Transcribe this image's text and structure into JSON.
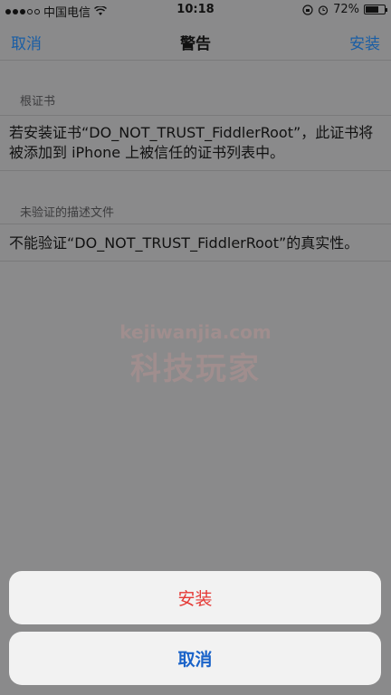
{
  "status_bar": {
    "carrier": "中国电信",
    "time": "10:18",
    "battery_percent": "72%",
    "battery_level": 0.72
  },
  "nav": {
    "left_label": "取消",
    "title": "警告",
    "right_label": "安装"
  },
  "sections": [
    {
      "header": "根证书",
      "body": "若安装证书“DO_NOT_TRUST_FiddlerRoot”，此证书将被添加到 iPhone 上被信任的证书列表中。"
    },
    {
      "header": "未验证的描述文件",
      "body": "不能验证“DO_NOT_TRUST_FiddlerRoot”的真实性。"
    }
  ],
  "watermark": {
    "url": "kejiwanjia.com",
    "text": "科技玩家"
  },
  "action_sheet": {
    "install_label": "安装",
    "cancel_label": "取消"
  },
  "colors": {
    "accent_blue": "#1a63c9",
    "destructive_red": "#e53935"
  }
}
